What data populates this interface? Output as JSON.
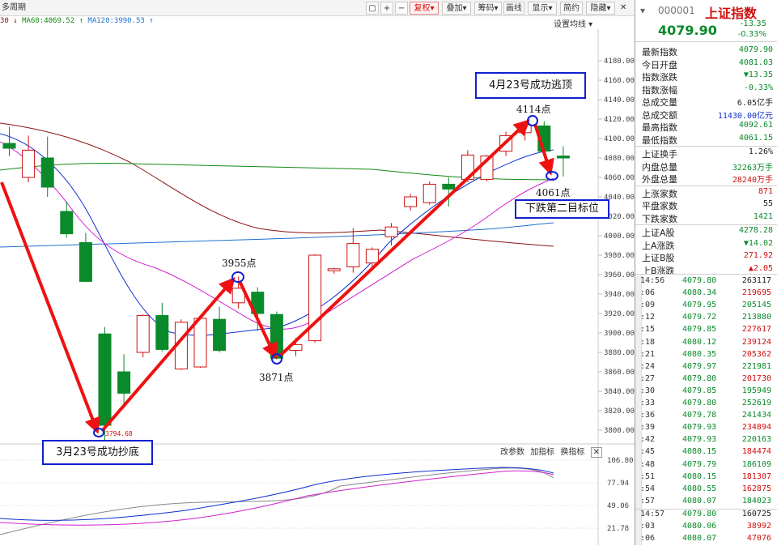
{
  "toolbar": {
    "period_label": "多周期",
    "buttons": [
      "复权",
      "叠加",
      "画线",
      "显示",
      "简约",
      "隐藏"
    ],
    "fuquan_label": "复权",
    "overlay_label": "叠加",
    "draw_label": "画线",
    "display_label": "显示",
    "simple_label": "简约",
    "hide_label": "隐藏",
    "sub_label": "筹码"
  },
  "ma_legend": {
    "ma30_tail": "30",
    "ma60": "MA60:4069.52",
    "ma120": "MA120:3990.53",
    "settings": "设置均线"
  },
  "colors": {
    "up": "#d01010",
    "down": "#0a8a2a",
    "annotation": "#1020d0",
    "arrow": "#ee1111",
    "ma5": "#222222",
    "ma10": "#d020d0",
    "ma20": "#1030d0",
    "ma30": "#8a1010",
    "ma60": "#118811",
    "ma120": "#1f6fd0"
  },
  "price_axis": [
    "4180.00",
    "4160.00",
    "4140.00",
    "4120.00",
    "4100.00",
    "4080.00",
    "4060.00",
    "4040.00",
    "4020.00",
    "4000.00",
    "3980.00",
    "3960.00",
    "3940.00",
    "3920.00",
    "3900.00",
    "3880.00",
    "3860.00",
    "3840.00",
    "3820.00",
    "3800.00"
  ],
  "indicator_axis": [
    "106.80",
    "77.94",
    "49.06",
    "21.78"
  ],
  "chart_data": {
    "type": "candlestick",
    "unit": "index points",
    "ylim": [
      3790,
      4190
    ],
    "candles": [
      {
        "o": 4095,
        "h": 4112,
        "l": 4082,
        "c": 4090
      },
      {
        "o": 4060,
        "h": 4103,
        "l": 4055,
        "c": 4088
      },
      {
        "o": 4080,
        "h": 4102,
        "l": 4040,
        "c": 4050
      },
      {
        "o": 4025,
        "h": 4035,
        "l": 3998,
        "c": 4002
      },
      {
        "o": 3993,
        "h": 4003,
        "l": 3960,
        "c": 3953
      },
      {
        "o": 3899,
        "h": 3906,
        "l": 3789,
        "c": 3805
      },
      {
        "o": 3860,
        "h": 3878,
        "l": 3823,
        "c": 3838
      },
      {
        "o": 3880,
        "h": 3919,
        "l": 3875,
        "c": 3918
      },
      {
        "o": 3918,
        "h": 3931,
        "l": 3881,
        "c": 3883
      },
      {
        "o": 3863,
        "h": 3914,
        "l": 3862,
        "c": 3911
      },
      {
        "o": 3865,
        "h": 3918,
        "l": 3864,
        "c": 3915
      },
      {
        "o": 3914,
        "h": 3927,
        "l": 3880,
        "c": 3882
      },
      {
        "o": 3931,
        "h": 3958,
        "l": 3925,
        "c": 3946
      },
      {
        "o": 3942,
        "h": 3947,
        "l": 3902,
        "c": 3920
      },
      {
        "o": 3919,
        "h": 3922,
        "l": 3873,
        "c": 3874
      },
      {
        "o": 3882,
        "h": 3895,
        "l": 3876,
        "c": 3888
      },
      {
        "o": 3892,
        "h": 3981,
        "l": 3890,
        "c": 3980
      },
      {
        "o": 3964,
        "h": 3967,
        "l": 3961,
        "c": 3966
      },
      {
        "o": 3968,
        "h": 4008,
        "l": 3962,
        "c": 3992
      },
      {
        "o": 3972,
        "h": 3988,
        "l": 3968,
        "c": 3986
      },
      {
        "o": 3999,
        "h": 4013,
        "l": 3990,
        "c": 4009
      },
      {
        "o": 4030,
        "h": 4043,
        "l": 4026,
        "c": 4040
      },
      {
        "o": 4034,
        "h": 4056,
        "l": 4032,
        "c": 4053
      },
      {
        "o": 4053,
        "h": 4060,
        "l": 4030,
        "c": 4048
      },
      {
        "o": 4058,
        "h": 4088,
        "l": 4055,
        "c": 4083
      },
      {
        "o": 4058,
        "h": 4083,
        "l": 4056,
        "c": 4082
      },
      {
        "o": 4087,
        "h": 4107,
        "l": 4082,
        "c": 4103
      },
      {
        "o": 4106,
        "h": 4116,
        "l": 4098,
        "c": 4114
      },
      {
        "o": 4113,
        "h": 4118,
        "l": 4085,
        "c": 4087
      },
      {
        "o": 4082,
        "h": 4092,
        "l": 4061,
        "c": 4080
      }
    ],
    "markers": {
      "low": "3794.68"
    },
    "annotations": {
      "bottom_box": "3月23号成功抄底",
      "top_box": "4月23号成功逃顶",
      "target_box": "下跌第二目标位",
      "p1": "3955点",
      "p2": "3871点",
      "p3": "4114点",
      "p4": "4061点"
    }
  },
  "indicator_panel": {
    "buttons": [
      "改参数",
      "加指标",
      "换指标"
    ],
    "param_label": "改参数",
    "add_label": "加指标",
    "change_label": "换指标"
  },
  "quote": {
    "code": "000001",
    "name": "上证指数",
    "price": "4079.90",
    "change": "-13.35",
    "change_pct": "-0.33%",
    "stats": [
      {
        "k": "最新指数",
        "v": "4079.90",
        "c": "#0a8a2a"
      },
      {
        "k": "今日开盘",
        "v": "4081.03",
        "c": "#0a8a2a"
      },
      {
        "k": "指数涨跌",
        "v": "▼13.35",
        "c": "#0a8a2a"
      },
      {
        "k": "指数涨幅",
        "v": "-0.33%",
        "c": "#0a8a2a"
      },
      {
        "k": "总成交量",
        "v": "6.05亿手",
        "c": "#222"
      },
      {
        "k": "总成交额",
        "v": "11430.00亿元",
        "c": "#1030d0"
      },
      {
        "k": "最高指数",
        "v": "4092.61",
        "c": "#0a8a2a"
      },
      {
        "k": "最低指数",
        "v": "4061.15",
        "c": "#0a8a2a"
      },
      {
        "k": "上证换手",
        "v": "1.26%",
        "c": "#222"
      },
      {
        "k": "内盘总量",
        "v": "32263万手",
        "c": "#0a8a2a"
      },
      {
        "k": "外盘总量",
        "v": "28240万手",
        "c": "#d01010"
      },
      {
        "k": "上涨家数",
        "v": "871",
        "c": "#d01010"
      },
      {
        "k": "平盘家数",
        "v": "55",
        "c": "#222"
      },
      {
        "k": "下跌家数",
        "v": "1421",
        "c": "#0a8a2a"
      },
      {
        "k": "上证A股",
        "v": "4278.28",
        "c": "#0a8a2a"
      },
      {
        "k": "上A涨跌",
        "v": "▼14.02",
        "c": "#0a8a2a"
      },
      {
        "k": "上证B股",
        "v": "271.92",
        "c": "#d01010"
      },
      {
        "k": "上B涨跌",
        "v": "▲2.05",
        "c": "#d01010"
      }
    ],
    "ticks": [
      {
        "t": "14:56",
        "p": "4079.80",
        "v": "263117",
        "vc": "#222"
      },
      {
        "t": ":06",
        "p": "4080.34",
        "v": "219695",
        "vc": "#d01010"
      },
      {
        "t": ":09",
        "p": "4079.95",
        "v": "205145",
        "vc": "#0a8a2a"
      },
      {
        "t": ":12",
        "p": "4079.72",
        "v": "213880",
        "vc": "#0a8a2a"
      },
      {
        "t": ":15",
        "p": "4079.85",
        "v": "227617",
        "vc": "#d01010"
      },
      {
        "t": ":18",
        "p": "4080.12",
        "v": "239124",
        "vc": "#d01010"
      },
      {
        "t": ":21",
        "p": "4080.35",
        "v": "205362",
        "vc": "#d01010"
      },
      {
        "t": ":24",
        "p": "4079.97",
        "v": "221981",
        "vc": "#0a8a2a"
      },
      {
        "t": ":27",
        "p": "4079.80",
        "v": "201730",
        "vc": "#d01010"
      },
      {
        "t": ":30",
        "p": "4079.85",
        "v": "195949",
        "vc": "#0a8a2a"
      },
      {
        "t": ":33",
        "p": "4079.80",
        "v": "252619",
        "vc": "#0a8a2a"
      },
      {
        "t": ":36",
        "p": "4079.78",
        "v": "241434",
        "vc": "#0a8a2a"
      },
      {
        "t": ":39",
        "p": "4079.93",
        "v": "234894",
        "vc": "#d01010"
      },
      {
        "t": ":42",
        "p": "4079.93",
        "v": "220163",
        "vc": "#0a8a2a"
      },
      {
        "t": ":45",
        "p": "4080.15",
        "v": "184474",
        "vc": "#d01010"
      },
      {
        "t": ":48",
        "p": "4079.79",
        "v": "186109",
        "vc": "#0a8a2a"
      },
      {
        "t": ":51",
        "p": "4080.15",
        "v": "181307",
        "vc": "#d01010"
      },
      {
        "t": ":54",
        "p": "4080.55",
        "v": "162875",
        "vc": "#d01010"
      },
      {
        "t": ":57",
        "p": "4080.07",
        "v": "184023",
        "vc": "#0a8a2a"
      },
      {
        "t": "14:57",
        "p": "4079.80",
        "v": "160725",
        "vc": "#222"
      },
      {
        "t": ":03",
        "p": "4080.06",
        "v": "38992",
        "vc": "#d01010"
      },
      {
        "t": ":06",
        "p": "4080.07",
        "v": "47076",
        "vc": "#d01010"
      }
    ]
  }
}
